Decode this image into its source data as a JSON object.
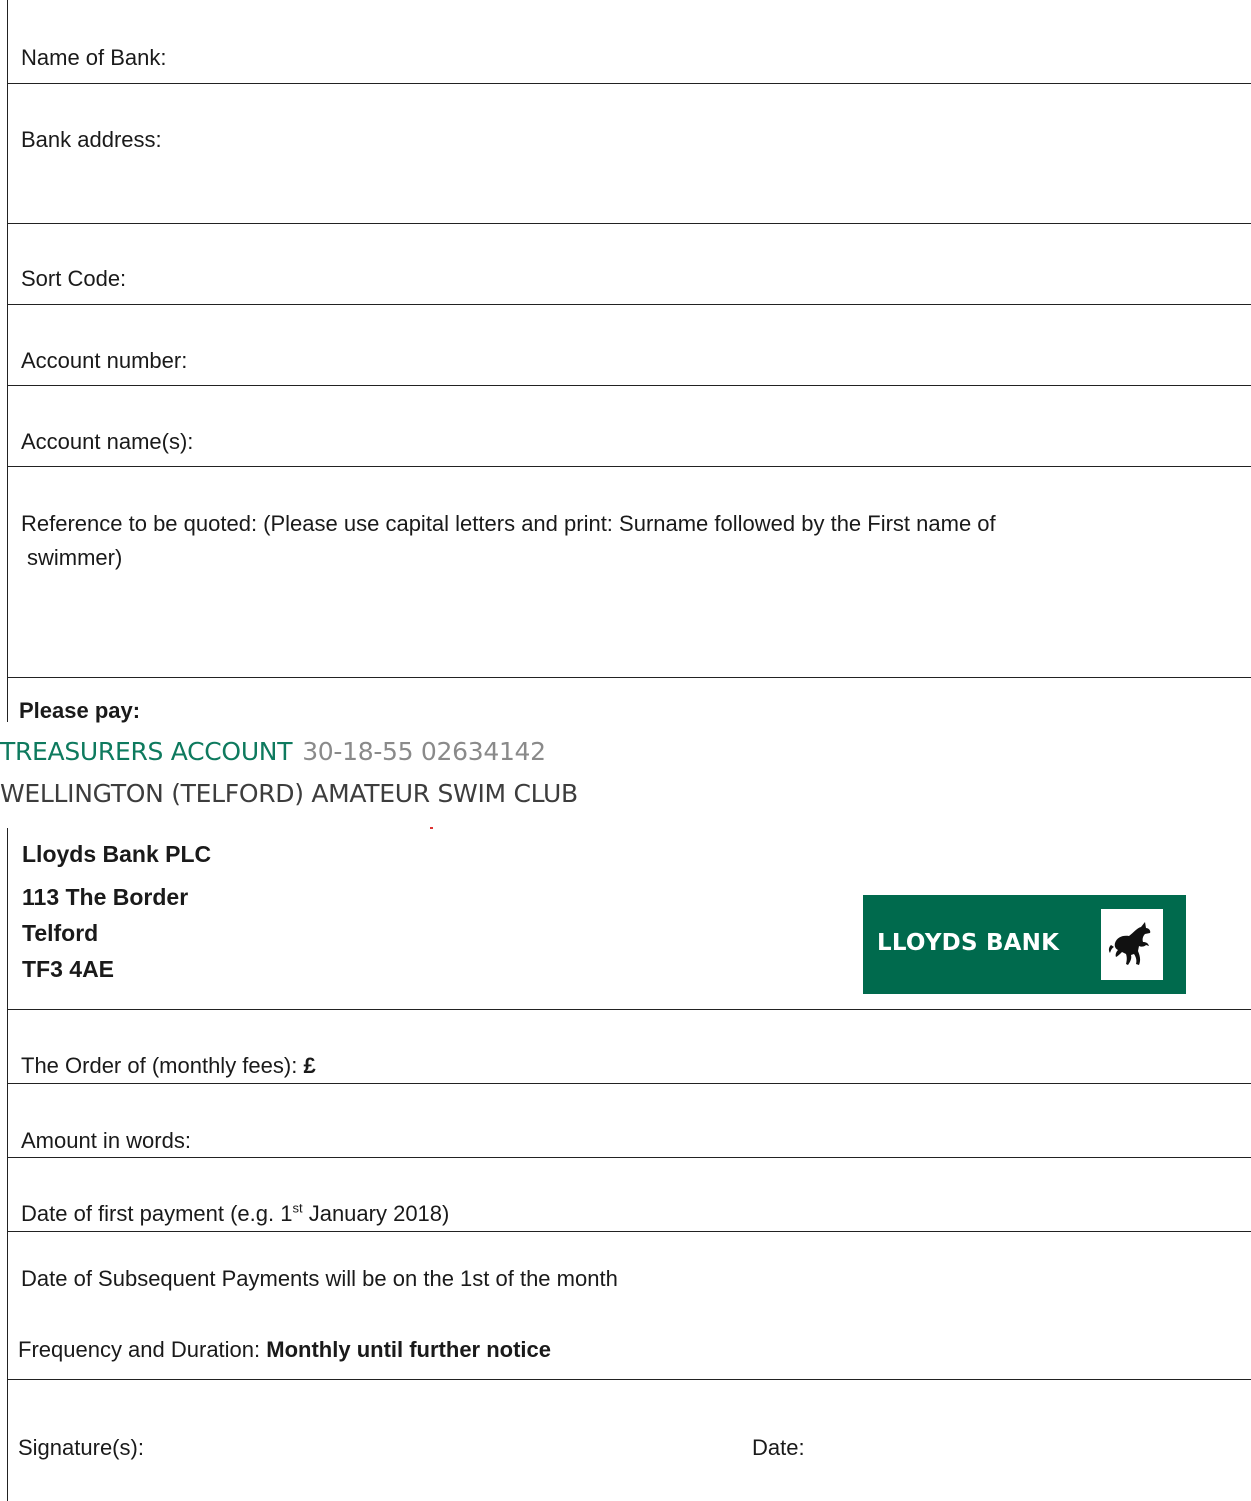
{
  "form": {
    "name_of_bank": "Name of Bank:",
    "bank_address": "Bank address:",
    "sort_code": "Sort Code:",
    "account_number": "Account number:",
    "account_names": "Account name(s):",
    "reference_line1": "Reference to be quoted: (Please use capital letters and print: Surname followed by the First name of",
    "reference_line2": "swimmer)",
    "please_pay": "Please pay:"
  },
  "payee": {
    "account_label": "TREASURERS ACCOUNT",
    "account_numbers": "30-18-55  02634142",
    "club_name": "WELLINGTON (TELFORD) AMATEUR SWIM CLUB"
  },
  "bank": {
    "name": "Lloyds Bank PLC",
    "street": "113 The Border",
    "town": "Telford",
    "postcode": "TF3 4AE",
    "logo_text": "LLOYDS BANK",
    "logo_color": "#006a4d"
  },
  "payment": {
    "order_label": "The Order of (monthly fees): ",
    "currency": "£",
    "amount_words": "Amount in words:",
    "first_payment_pre": "Date of first payment (e.g. 1",
    "first_payment_sup": "st",
    "first_payment_post": " January 2018)",
    "subsequent": "Date of Subsequent Payments will be on the 1st of the month",
    "frequency_label": "Frequency and Duration: ",
    "frequency_value": "Monthly until further notice",
    "signature": "Signature(s):",
    "date": "Date:"
  }
}
